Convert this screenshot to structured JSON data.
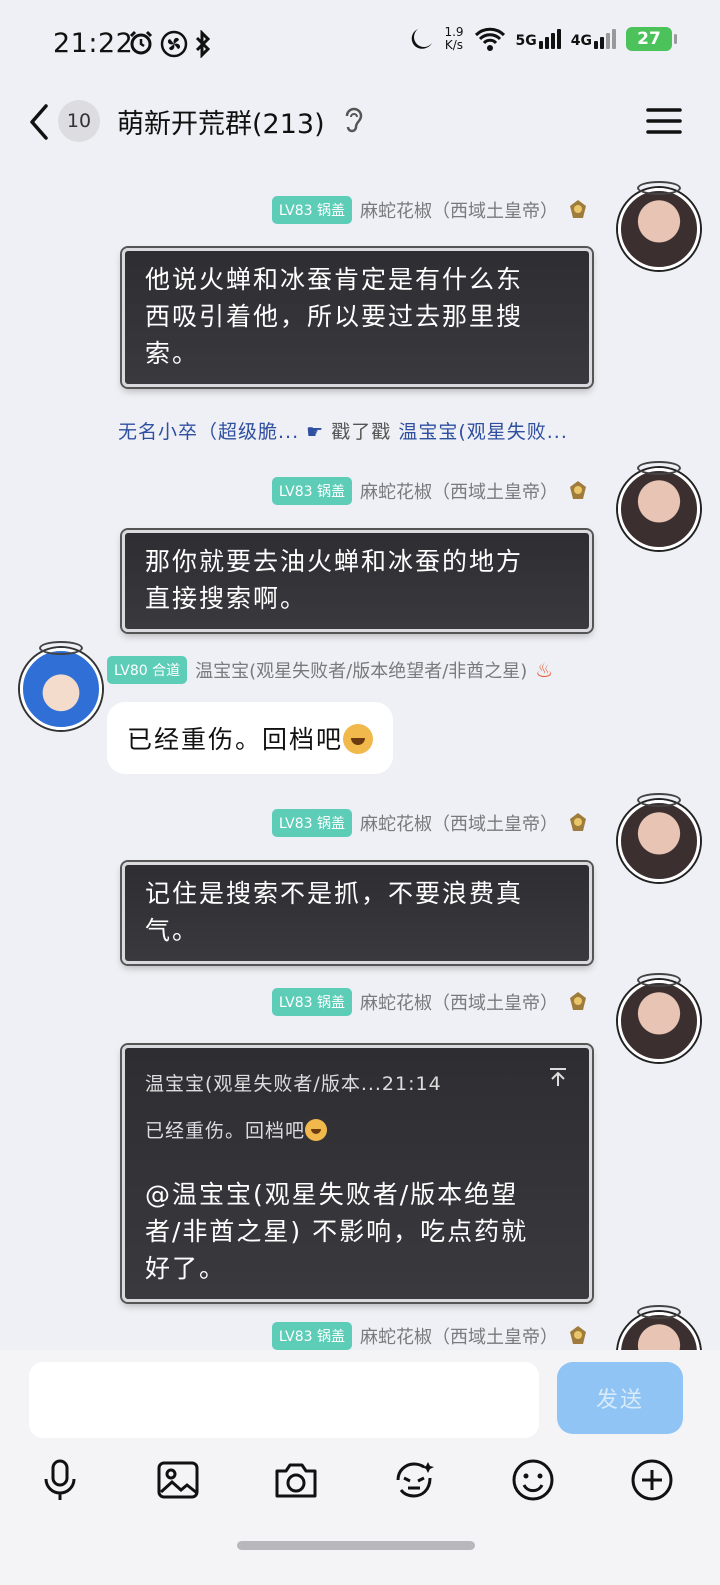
{
  "status_bar": {
    "time": "21:22",
    "net_rate_value": "1.9",
    "net_rate_unit": "K/s",
    "sig1": "5G",
    "sig2": "4G",
    "battery": "27"
  },
  "header": {
    "unread_count": "10",
    "title": "萌新开荒群(213)"
  },
  "messages": [
    {
      "level": "LV83 锅盖",
      "sender": "麻蛇花椒（西域土皇帝）",
      "text_lines": [
        "他说火蝉和冰蚕肯定是有什么东",
        "西吸引着他，所以要过去那里搜",
        "索。"
      ]
    },
    {
      "system": true,
      "actor": "无名小卒（超级脆...",
      "action": "戳了戳",
      "target": "温宝宝(观星失败..."
    },
    {
      "level": "LV83 锅盖",
      "sender": "麻蛇花椒（西域土皇帝）",
      "text_lines": [
        "那你就要去油火蝉和冰蚕的地方",
        "直接搜索啊。"
      ]
    },
    {
      "level": "LV80 合道",
      "sender": "温宝宝(观星失败者/版本绝望者/非酋之星)",
      "text": "已经重伤。回档吧"
    },
    {
      "level": "LV83 锅盖",
      "sender": "麻蛇花椒（西域土皇帝）",
      "text_lines": [
        "记住是搜索不是抓，不要浪费真",
        "气。"
      ]
    },
    {
      "level": "LV83 锅盖",
      "sender": "麻蛇花椒（西域土皇帝）",
      "quote_author": "温宝宝(观星失败者/版本...21:14",
      "quote_text": "已经重伤。回档吧",
      "text_lines": [
        "@温宝宝(观星失败者/版本绝望",
        "者/非酋之星) 不影响，吃点药就",
        "好了。"
      ]
    },
    {
      "level": "LV83 锅盖",
      "sender": "麻蛇花椒（西域土皇帝）"
    }
  ],
  "composer": {
    "send_label": "发送",
    "input_value": ""
  },
  "toolbar": [
    "microphone-icon",
    "image-icon",
    "camera-icon",
    "sticker-icon",
    "emoji-icon",
    "plus-icon"
  ],
  "colors": {
    "background": "#eff0f5",
    "level_badge": "#5dcdb8",
    "send_button": "#8fc4f4",
    "system_link": "#2f4fa0",
    "battery": "#4cc35a"
  }
}
